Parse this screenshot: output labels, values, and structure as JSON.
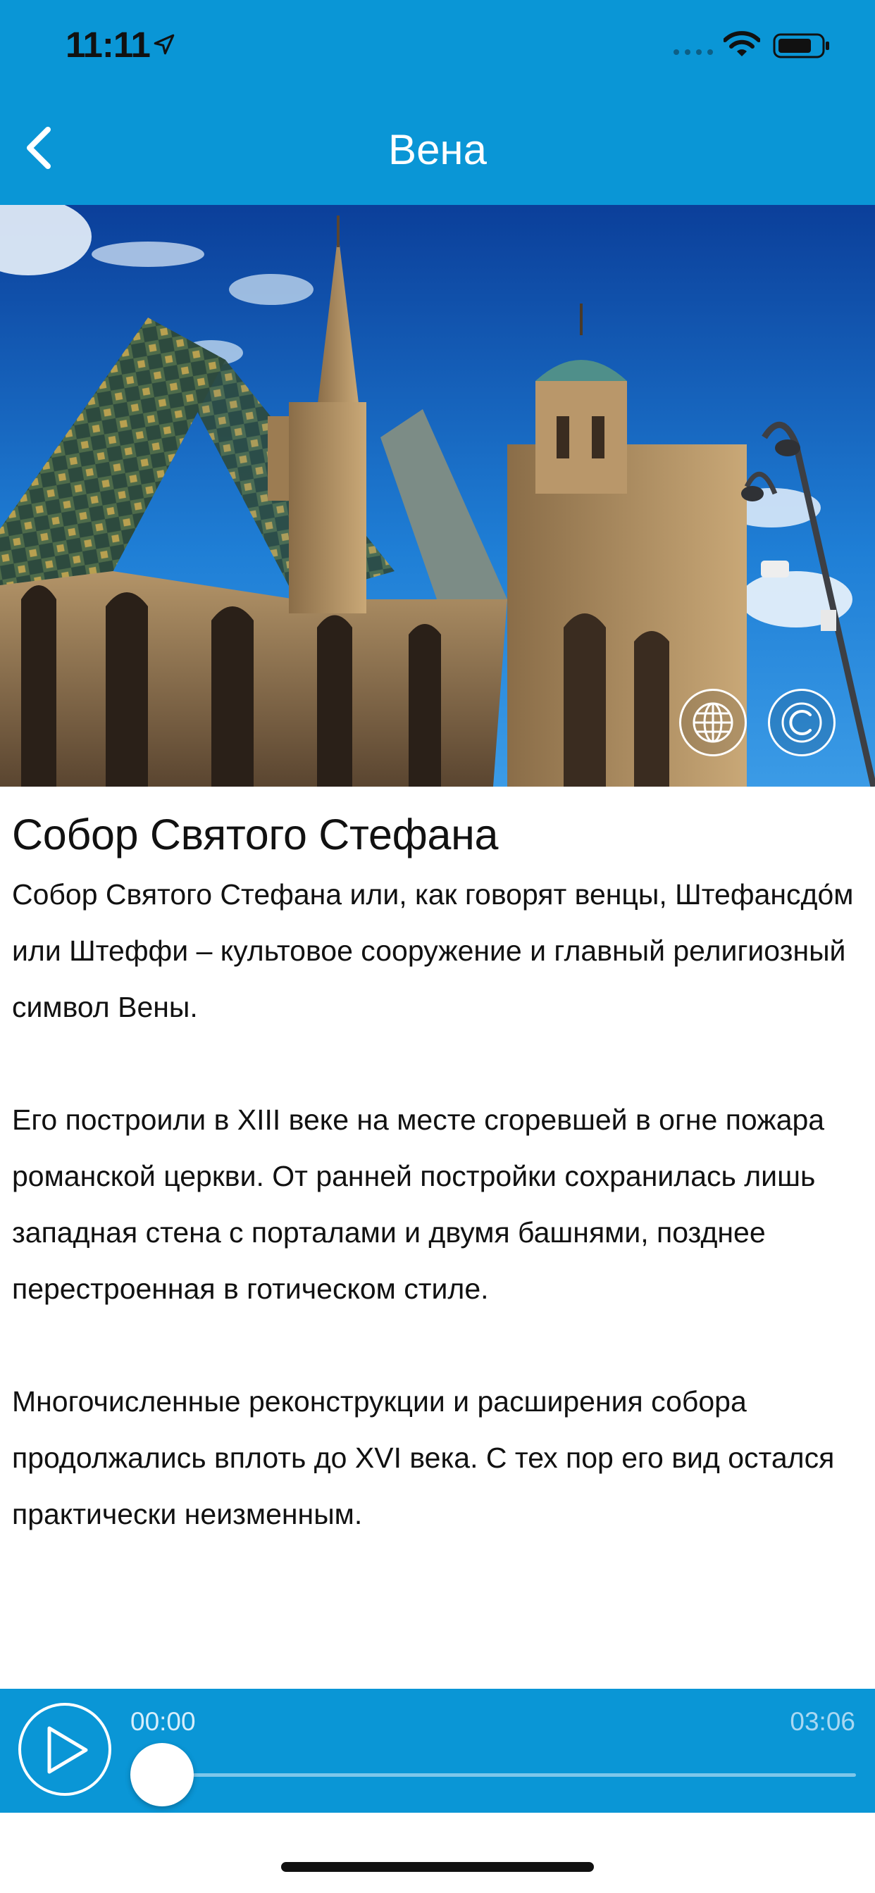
{
  "status_bar": {
    "time": "11:11",
    "icons": [
      "location-arrow-icon",
      "cellular-signal-icon",
      "wifi-icon",
      "battery-icon"
    ]
  },
  "nav": {
    "title": "Вена",
    "back_icon": "chevron-left-icon"
  },
  "hero": {
    "image_alt": "Собор Святого Стефана",
    "buttons": [
      {
        "icon": "globe-icon"
      },
      {
        "icon": "copyright-icon"
      }
    ]
  },
  "article": {
    "title": "Собор Святого Стефана",
    "paragraphs": [
      "Собор Святого Стефана или, как говорят венцы, Штефансдо́м или Штеффи – культовое сооружение и главный религиозный символ Вены.",
      "Его построили в XIII веке на месте сгоревшей в огне пожара романской церкви. От ранней постройки сохранилась лишь западная стена с порталами и двумя башнями, позднее перестроенная в готическом стиле.",
      "Многочисленные реконструкции и расширения собора продолжались вплоть до XVI века. С тех пор его вид остался практически неизменным."
    ]
  },
  "player": {
    "play_icon": "play-icon",
    "current_time": "00:00",
    "total_time": "03:06",
    "progress": 0
  },
  "colors": {
    "brand_blue": "#0a96d6",
    "text": "#111111"
  }
}
